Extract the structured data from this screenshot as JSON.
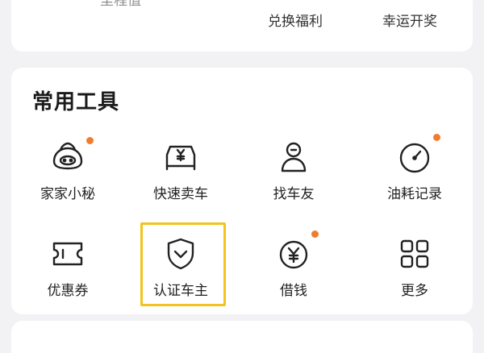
{
  "top_card": {
    "cut_label": "里程值",
    "items": [
      {
        "label": "兑换福利"
      },
      {
        "label": "幸运开奖"
      }
    ]
  },
  "tools": {
    "title": "常用工具",
    "items": [
      {
        "label": "家家小秘",
        "icon": "assistant-icon",
        "dot": true
      },
      {
        "label": "快速卖车",
        "icon": "sell-car-icon",
        "dot": false
      },
      {
        "label": "找车友",
        "icon": "find-friends-icon",
        "dot": false
      },
      {
        "label": "油耗记录",
        "icon": "fuel-gauge-icon",
        "dot": true
      },
      {
        "label": "优惠券",
        "icon": "coupon-icon",
        "dot": false
      },
      {
        "label": "认证车主",
        "icon": "shield-check-icon",
        "dot": false,
        "highlighted": true
      },
      {
        "label": "借钱",
        "icon": "yen-coin-icon",
        "dot": true
      },
      {
        "label": "更多",
        "icon": "grid-more-icon",
        "dot": false
      }
    ],
    "accent_dot_color": "#f07d2c",
    "highlight_color": "#f3c41f"
  }
}
